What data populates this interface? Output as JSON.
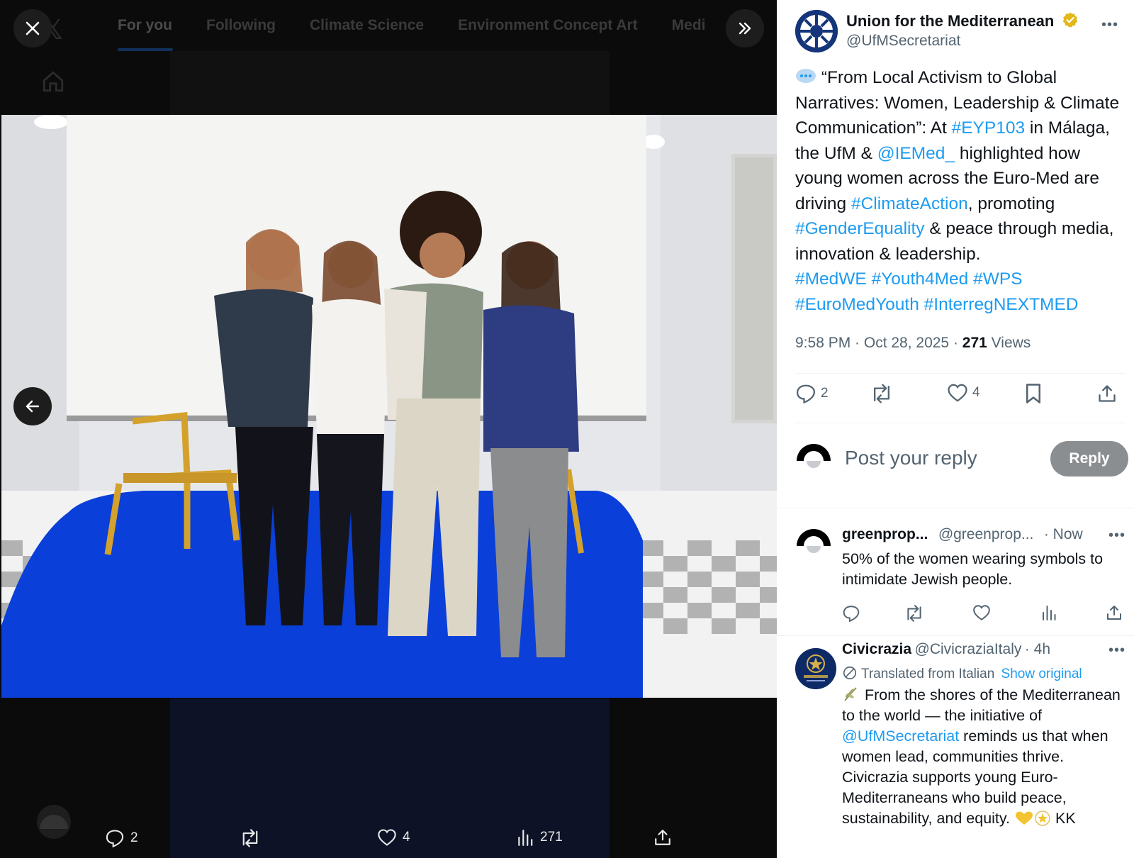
{
  "viewer": {
    "dim_tabs": [
      "For you",
      "Following",
      "Climate Science",
      "Environment Concept Art",
      "Medi"
    ],
    "bottom_bar": {
      "replies": "2",
      "likes": "4",
      "views": "271"
    }
  },
  "post": {
    "author_name": "Union for the Mediterranean",
    "author_handle": "@UfMSecretariat",
    "text_parts": {
      "p1": "“From Local Activism to Global Narratives: Women, Leadership & Climate Communication”: At ",
      "tag1": "#EYP103",
      "p2": " in Málaga, the UfM & ",
      "tag2": "@IEMed_",
      "p3": " highlighted how young women across the Euro-Med are driving ",
      "tag3": "#ClimateAction",
      "p4": ", promoting ",
      "tag4": "#GenderEquality",
      "p5": " & peace through media, innovation & leadership.",
      "tag5": "#MedWE",
      "tag6": "#Youth4Med",
      "tag7": "#WPS",
      "tag8": "#EuroMedYouth",
      "tag9": "#InterregNEXTMED"
    },
    "time": "9:58 PM · Oct 28, 2025 · ",
    "views_count": "271",
    "views_label": " Views",
    "reply_count": "2",
    "like_count": "4"
  },
  "reply_box": {
    "placeholder": "Post your reply",
    "button": "Reply"
  },
  "replies": [
    {
      "name": "greenprop...",
      "handle": "@greenprop...",
      "time": "· Now",
      "text": "50% of the women wearing symbols to intimidate Jewish people."
    },
    {
      "name": "Civicrazia",
      "handle": "@CivicraziaItaly",
      "time": "· 4h",
      "translated": "Translated from Italian",
      "show_original": "Show original",
      "text_a": " From the shores of the Mediterranean to the world — the initiative of ",
      "mention": "@UfMSecretariat",
      "text_b": " reminds us that when women lead, communities thrive. Civicrazia supports young Euro-Mediterraneans who build peace, sustainability, and equity.",
      "text_c": " KK"
    }
  ],
  "colors": {
    "link": "#1d9bf0",
    "muted": "#536471",
    "text": "#0f1419",
    "carpet": "#0a3fd9"
  }
}
